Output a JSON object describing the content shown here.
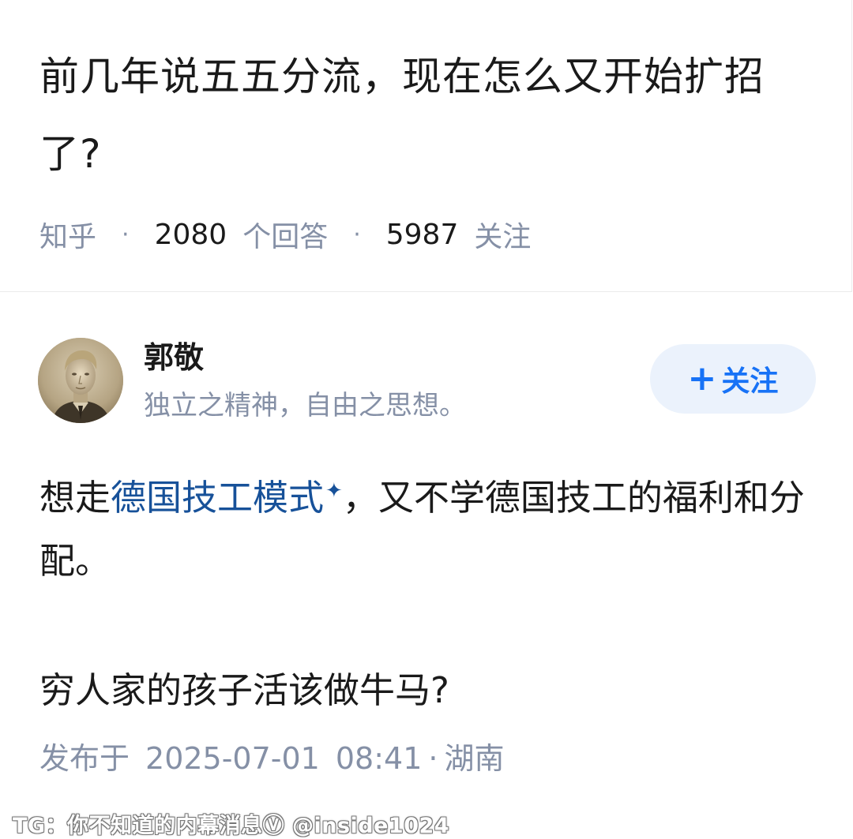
{
  "question": {
    "title": "前几年说五五分流，现在怎么又开始扩招了?",
    "source": "知乎",
    "answers_count": "2080",
    "answers_label": "个回答",
    "followers_count": "5987",
    "followers_label": "关注",
    "separator": "·"
  },
  "author": {
    "name": "郭敬",
    "bio": "独立之精神，自由之思想。",
    "avatar_icon": "portrait-avatar",
    "follow_plus": "+",
    "follow_label": "关注"
  },
  "answer": {
    "p1_before": "想走",
    "p1_link": "德国技工模式",
    "p1_link_icon": "✦",
    "p1_after": "，又不学德国技工的福利和分配。",
    "p2": "穷人家的孩子活该做牛马?",
    "published_prefix": "发布于",
    "published_date": "2025-07-01",
    "published_time": "08:41",
    "location_separator": "·",
    "location": "湖南"
  },
  "watermark": {
    "text": "TG：你不知道的内幕消息Ⓥ @inside1024"
  },
  "colors": {
    "text": "#1a1a1a",
    "meta": "#8590a6",
    "link": "#175199",
    "brand": "#1772f6",
    "follow_bg": "#ebf2fc"
  }
}
